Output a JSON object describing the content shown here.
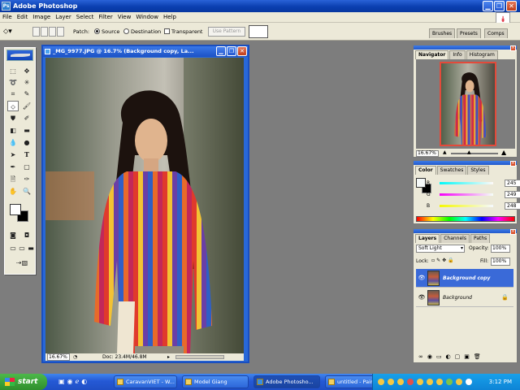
{
  "app": {
    "title": "Adobe Photoshop",
    "logo_text": "Ps"
  },
  "menu": [
    "File",
    "Edit",
    "Image",
    "Layer",
    "Select",
    "Filter",
    "View",
    "Window",
    "Help"
  ],
  "options": {
    "patch_label": "Patch:",
    "source_label": "Source",
    "destination_label": "Destination",
    "transparent_label": "Transparent",
    "use_pattern_label": "Use Pattern",
    "source_selected": true
  },
  "palette_well": [
    "Brushes",
    "Presets",
    "Comps"
  ],
  "document": {
    "title": "_MG_9977.JPG @ 16.7% (Background copy, La...",
    "zoom": "16.67%",
    "doc_info": "Doc: 23.4M/46.8M"
  },
  "navigator": {
    "tabs": [
      "Navigator",
      "Info",
      "Histogram"
    ],
    "zoom": "16.67%"
  },
  "color": {
    "tabs": [
      "Color",
      "Swatches",
      "Styles"
    ],
    "r_label": "R",
    "g_label": "G",
    "b_label": "B",
    "r": "245",
    "g": "249",
    "b": "248"
  },
  "layers": {
    "tabs": [
      "Layers",
      "Channels",
      "Paths"
    ],
    "blend_mode": "Soft Light",
    "opacity_label": "Opacity:",
    "opacity": "100%",
    "lock_label": "Lock:",
    "fill_label": "Fill:",
    "fill": "100%",
    "items": [
      {
        "name": "Background copy",
        "selected": true
      },
      {
        "name": "Background",
        "selected": false
      }
    ]
  },
  "taskbar": {
    "start_label": "start",
    "tasks": [
      "CaravanVIET - W...",
      "Model Giang",
      "Adobe Photosho...",
      "untitled - Paint"
    ],
    "clock": "3:12 PM"
  },
  "colors": {
    "xp_blue": "#0a3fb0",
    "start_green": "#2f8f2d",
    "tray_blue": "#0e84d6",
    "selected_layer": "#3a6ad8"
  }
}
